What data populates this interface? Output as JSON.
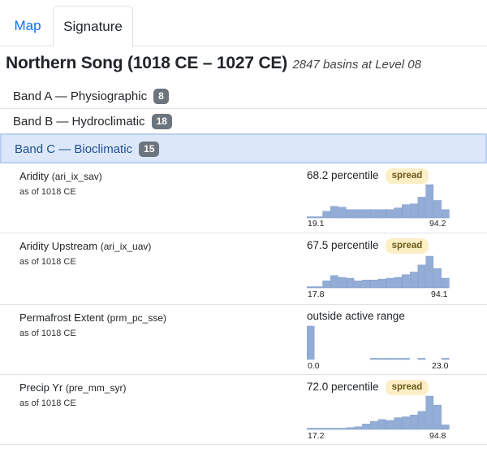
{
  "tabs": [
    {
      "label": "Map",
      "active": false
    },
    {
      "label": "Signature",
      "active": true
    }
  ],
  "title": {
    "main": "Northern Song (1018 CE – 1027 CE)",
    "subtitle": "2847 basins at Level 08"
  },
  "bands": [
    {
      "label": "Band A — Physiographic",
      "count": "8",
      "selected": false
    },
    {
      "label": "Band B — Hydroclimatic",
      "count": "18",
      "selected": false
    },
    {
      "label": "Band C — Bioclimatic",
      "count": "15",
      "selected": true
    }
  ],
  "variables": [
    {
      "name": "Aridity",
      "code": "(ari_ix_sav)",
      "as_of": "as of 1018 CE",
      "status": "68.2 percentile",
      "badge": "spread",
      "hist_min": "19.1",
      "hist_max": "94.2",
      "histogram": [
        1,
        1,
        8,
        14,
        13,
        10,
        10,
        10,
        10,
        10,
        10,
        12,
        16,
        17,
        25,
        40,
        21,
        10
      ]
    },
    {
      "name": "Aridity Upstream",
      "code": "(ari_ix_uav)",
      "as_of": "as of 1018 CE",
      "status": "67.5 percentile",
      "badge": "spread",
      "hist_min": "17.8",
      "hist_max": "94.1",
      "histogram": [
        1,
        1,
        8,
        14,
        12,
        11,
        8,
        9,
        9,
        10,
        11,
        12,
        15,
        18,
        26,
        36,
        22,
        11
      ]
    },
    {
      "name": "Permafrost Extent",
      "code": "(prm_pc_sse)",
      "as_of": "as of 1018 CE",
      "status": "outside active range",
      "badge": "",
      "hist_min": "0.0",
      "hist_max": "23.0",
      "histogram": [
        40,
        0,
        0,
        0,
        0,
        0,
        0,
        0,
        1,
        1,
        1,
        1,
        1,
        0,
        1,
        0,
        0,
        1
      ]
    },
    {
      "name": "Precip Yr",
      "code": "(pre_mm_syr)",
      "as_of": "as of 1018 CE",
      "status": "72.0 percentile",
      "badge": "spread",
      "hist_min": "17.2",
      "hist_max": "94.8",
      "histogram": [
        1,
        1,
        1,
        1,
        1,
        2,
        3,
        6,
        9,
        11,
        10,
        13,
        14,
        16,
        20,
        37,
        27,
        5
      ]
    }
  ]
}
